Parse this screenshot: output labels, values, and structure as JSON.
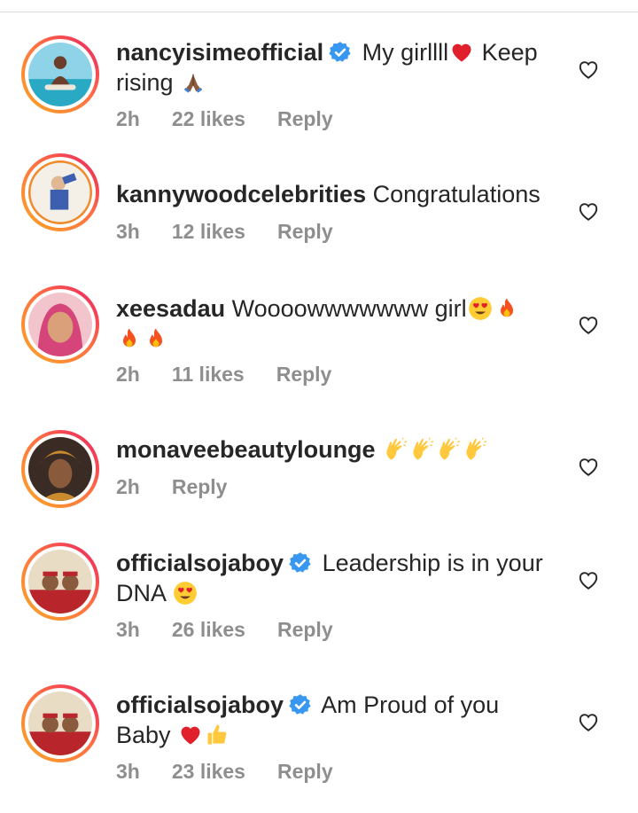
{
  "comments": [
    {
      "username": "nancyisimeofficial",
      "verified": true,
      "text_parts": [
        "My girllll",
        "Keep rising"
      ],
      "time": "2h",
      "likes": "22 likes",
      "reply": "Reply"
    },
    {
      "username": "kannywoodcelebrities",
      "verified": false,
      "text_parts": [
        "Congratulations"
      ],
      "time": "3h",
      "likes": "12 likes",
      "reply": "Reply"
    },
    {
      "username": "xeesadau",
      "verified": false,
      "text_parts": [
        "Woooowwwwwww girl"
      ],
      "time": "2h",
      "likes": "11 likes",
      "reply": "Reply"
    },
    {
      "username": "monaveebeautylounge",
      "verified": false,
      "text_parts": [],
      "time": "2h",
      "reply": "Reply"
    },
    {
      "username": "officialsojaboy",
      "verified": true,
      "text_parts": [
        "Leadership is in your DNA"
      ],
      "time": "3h",
      "likes": "26 likes",
      "reply": "Reply"
    },
    {
      "username": "officialsojaboy",
      "verified": true,
      "text_parts": [
        "Am Proud of you Baby"
      ],
      "time": "3h",
      "likes": "23 likes",
      "reply": "Reply"
    }
  ],
  "icons": {
    "verified": "verified-badge-icon",
    "like": "heart-outline-icon",
    "emojis": [
      "red-heart",
      "folded-hands",
      "smiling-face-heart-eyes",
      "fire",
      "clapping-hands",
      "thumbs-up"
    ]
  },
  "colors": {
    "verified": "#3897f0",
    "muted": "#8e8e8e",
    "text": "#262626",
    "ring_start": "#f9a825",
    "ring_end": "#e91e63"
  }
}
